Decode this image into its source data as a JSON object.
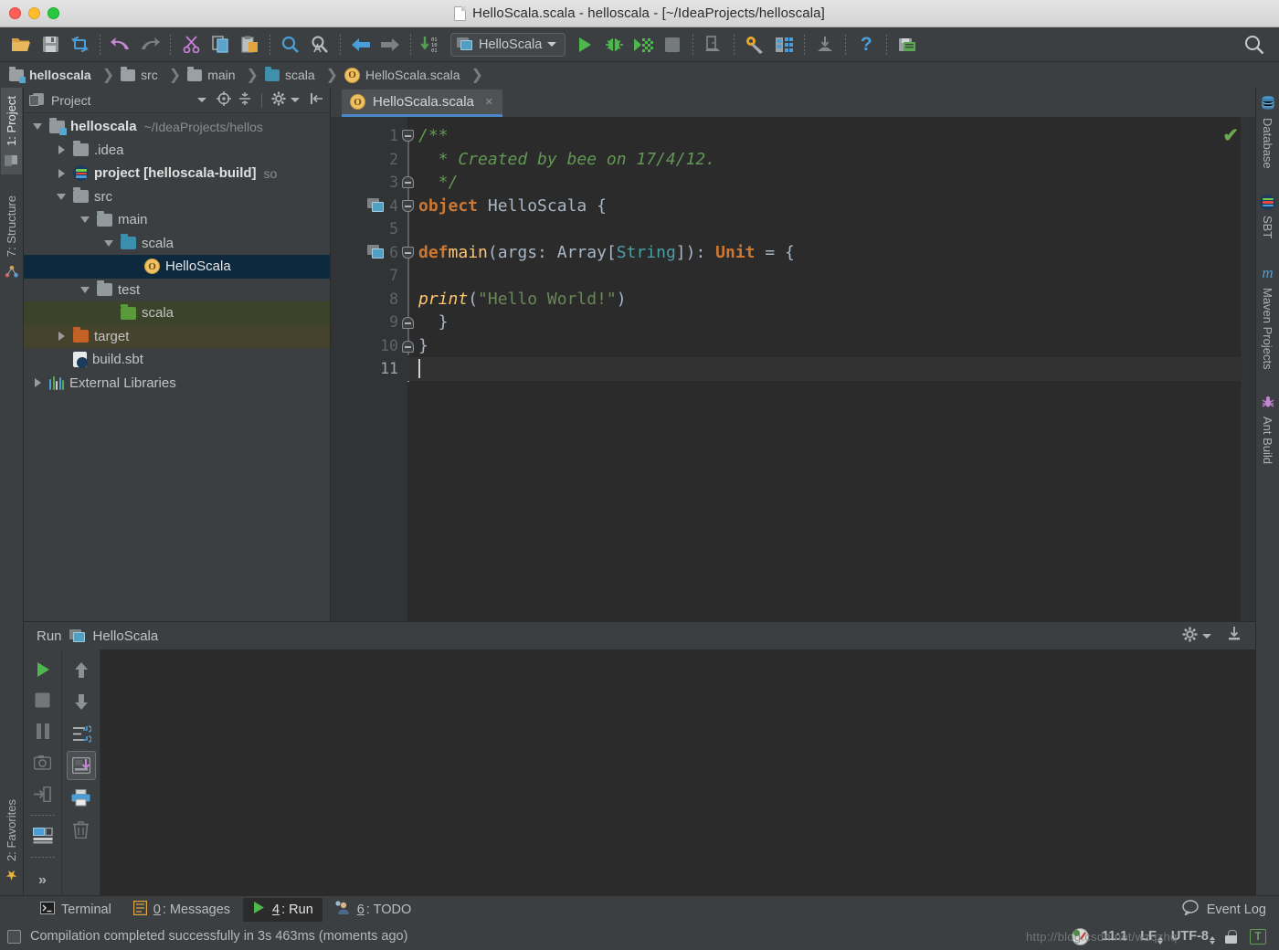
{
  "window": {
    "title": "HelloScala.scala - helloscala - [~/IdeaProjects/helloscala]",
    "file_icon": "file-icon"
  },
  "toolbar": {
    "items": [
      {
        "name": "open-project-icon",
        "label": "Open"
      },
      {
        "name": "save-all-icon",
        "label": "Save All"
      },
      {
        "name": "synchronize-icon",
        "label": "Synchronize"
      },
      {
        "name": "undo-icon",
        "label": "Undo"
      },
      {
        "name": "redo-icon",
        "label": "Redo"
      },
      {
        "name": "cut-icon",
        "label": "Cut"
      },
      {
        "name": "copy-icon",
        "label": "Copy"
      },
      {
        "name": "paste-icon",
        "label": "Paste"
      },
      {
        "name": "find-icon",
        "label": "Find"
      },
      {
        "name": "replace-icon",
        "label": "Replace"
      },
      {
        "name": "back-icon",
        "label": "Back"
      },
      {
        "name": "forward-icon",
        "label": "Forward"
      },
      {
        "name": "compile-icon",
        "label": "Compile"
      },
      {
        "name": "run-icon",
        "label": "Run"
      },
      {
        "name": "debug-icon",
        "label": "Debug"
      },
      {
        "name": "run-coverage-icon",
        "label": "Run with Coverage"
      },
      {
        "name": "stop-icon",
        "label": "Stop"
      },
      {
        "name": "update-app-icon",
        "label": "Update Application"
      },
      {
        "name": "settings-icon",
        "label": "Settings"
      },
      {
        "name": "project-structure-icon",
        "label": "Project Structure"
      },
      {
        "name": "install-icon",
        "label": "Install"
      },
      {
        "name": "help-icon",
        "label": "Help"
      },
      {
        "name": "sbt-refresh-icon",
        "label": "SBT"
      },
      {
        "name": "search-everywhere-icon",
        "label": "Search Everywhere"
      }
    ],
    "run_config": {
      "name": "HelloScala",
      "icon": "run-config-icon",
      "chevron": "chevron-down-icon"
    },
    "help_glyph": "?"
  },
  "breadcrumb": [
    {
      "label": "helloscala",
      "icon": "module-folder-icon",
      "bold": true
    },
    {
      "label": "src",
      "icon": "folder-icon",
      "bold": false
    },
    {
      "label": "main",
      "icon": "folder-icon",
      "bold": false
    },
    {
      "label": "scala",
      "icon": "source-folder-icon",
      "bold": false
    },
    {
      "label": "HelloScala.scala",
      "icon": "scala-object-icon",
      "bold": false
    }
  ],
  "left_sidebar": [
    {
      "label": "1: Project",
      "active": true,
      "icon": "project-icon"
    },
    {
      "label": "7: Structure",
      "active": false,
      "icon": "structure-icon"
    },
    {
      "label": "2: Favorites",
      "active": false,
      "icon": "star-icon"
    }
  ],
  "right_sidebar": [
    {
      "label": "Database",
      "icon": "database-icon"
    },
    {
      "label": "SBT",
      "icon": "sbt-icon"
    },
    {
      "label": "Maven Projects",
      "icon": "maven-icon"
    },
    {
      "label": "Ant Build",
      "icon": "ant-icon"
    }
  ],
  "project_panel": {
    "title": "Project",
    "header_icons": [
      {
        "name": "project-view-icon"
      },
      {
        "name": "chevron-down-icon"
      },
      {
        "name": "locate-file-icon"
      },
      {
        "name": "collapse-all-icon"
      },
      {
        "name": "gear-icon"
      },
      {
        "name": "hide-panel-icon"
      }
    ],
    "tree": [
      {
        "label": "helloscala",
        "sub": "~/IdeaProjects/hellos",
        "depth": 0,
        "twisty": "open",
        "icon": "module-folder-icon",
        "bold": true,
        "state": "none"
      },
      {
        "label": ".idea",
        "sub": "",
        "depth": 1,
        "twisty": "closed",
        "icon": "folder-icon",
        "bold": false,
        "state": "none"
      },
      {
        "label": "project [helloscala-build]",
        "sub": "so",
        "depth": 1,
        "twisty": "closed",
        "icon": "sbt-module-icon",
        "bold": true,
        "state": "none"
      },
      {
        "label": "src",
        "sub": "",
        "depth": 1,
        "twisty": "open",
        "icon": "folder-icon",
        "bold": false,
        "state": "none"
      },
      {
        "label": "main",
        "sub": "",
        "depth": 2,
        "twisty": "open",
        "icon": "folder-icon",
        "bold": false,
        "state": "none"
      },
      {
        "label": "scala",
        "sub": "",
        "depth": 3,
        "twisty": "open",
        "icon": "source-folder-icon",
        "bold": false,
        "state": "none"
      },
      {
        "label": "HelloScala",
        "sub": "",
        "depth": 4,
        "twisty": "none",
        "icon": "scala-object-icon",
        "bold": false,
        "state": "selected"
      },
      {
        "label": "test",
        "sub": "",
        "depth": 2,
        "twisty": "open",
        "icon": "folder-icon",
        "bold": false,
        "state": "none"
      },
      {
        "label": "scala",
        "sub": "",
        "depth": 3,
        "twisty": "none",
        "icon": "test-source-folder-icon",
        "bold": false,
        "state": "green"
      },
      {
        "label": "target",
        "sub": "",
        "depth": 1,
        "twisty": "closed",
        "icon": "excluded-folder-icon",
        "bold": false,
        "state": "olive"
      },
      {
        "label": "build.sbt",
        "sub": "",
        "depth": 1,
        "twisty": "none",
        "icon": "sbt-file-icon",
        "bold": false,
        "state": "none"
      },
      {
        "label": "External Libraries",
        "sub": "",
        "depth": 0,
        "twisty": "closed",
        "icon": "libraries-icon",
        "bold": false,
        "state": "none"
      }
    ]
  },
  "editor": {
    "tab": {
      "label": "HelloScala.scala",
      "icon": "scala-object-icon",
      "close": "×"
    },
    "inspection_status": "✔",
    "lines": [
      {
        "n": "1",
        "gutter_run": false,
        "fold": "down"
      },
      {
        "n": "2",
        "gutter_run": false,
        "fold": "none"
      },
      {
        "n": "3",
        "gutter_run": false,
        "fold": "up"
      },
      {
        "n": "4",
        "gutter_run": true,
        "fold": "down"
      },
      {
        "n": "5",
        "gutter_run": false,
        "fold": "none"
      },
      {
        "n": "6",
        "gutter_run": true,
        "fold": "down"
      },
      {
        "n": "7",
        "gutter_run": false,
        "fold": "none"
      },
      {
        "n": "8",
        "gutter_run": false,
        "fold": "none"
      },
      {
        "n": "9",
        "gutter_run": false,
        "fold": "up"
      },
      {
        "n": "10",
        "gutter_run": false,
        "fold": "up"
      },
      {
        "n": "11",
        "gutter_run": false,
        "fold": "none"
      }
    ],
    "code_text": [
      "/**",
      "  * Created by bee on 17/4/12.",
      "  */",
      "object HelloScala {",
      "",
      "  def main(args: Array[String]): Unit = {",
      "",
      "    print(\"Hello World!\")",
      "  }",
      "}",
      ""
    ],
    "cursor_line": 11
  },
  "run_window": {
    "title": "Run",
    "config_name": "HelloScala",
    "config_icon": "run-config-icon",
    "header_icons": [
      {
        "name": "gear-icon"
      },
      {
        "name": "hide-panel-icon"
      }
    ],
    "left_tools": [
      {
        "name": "rerun-button",
        "label": "Rerun"
      },
      {
        "name": "stop-button",
        "label": "Stop"
      },
      {
        "name": "pause-button",
        "label": "Pause Output"
      },
      {
        "name": "dump-threads-button",
        "label": "Dump Threads"
      },
      {
        "name": "exit-button",
        "label": "Exit"
      },
      {
        "name": "restore-layout-button",
        "label": "Restore Layout"
      }
    ],
    "right_tools": [
      {
        "name": "up-stacktrace-button",
        "label": "Up the Stack Trace"
      },
      {
        "name": "down-stacktrace-button",
        "label": "Down the Stack Trace"
      },
      {
        "name": "soft-wrap-button",
        "label": "Soft-Wrap"
      },
      {
        "name": "scroll-to-end-button",
        "label": "Scroll to End"
      },
      {
        "name": "print-button",
        "label": "Print"
      },
      {
        "name": "clear-all-button",
        "label": "Clear All"
      }
    ],
    "expand_glyph": "»",
    "console_text": ""
  },
  "bottom_tabs": [
    {
      "label": "Terminal",
      "num": "",
      "icon": "terminal-icon",
      "active": false
    },
    {
      "label": ": Messages",
      "num": "0",
      "icon": "messages-icon",
      "active": false
    },
    {
      "label": ": Run",
      "num": "4",
      "icon": "run-icon",
      "active": true
    },
    {
      "label": ": TODO",
      "num": "6",
      "icon": "todo-icon",
      "active": false
    }
  ],
  "event_log": {
    "label": "Event Log",
    "icon": "balloon-icon"
  },
  "status_bar": {
    "message": "Compilation completed successfully in 3s 463ms (moments ago)",
    "caret_position": "11:1",
    "line_separator": "LF",
    "encoding": "UTF-8",
    "lock_icon": "lock-icon",
    "indent_badge": "T",
    "memory_icon": "memory-indicator-icon",
    "watermark": "http://blog.csdn.net/wzqzhq"
  },
  "colors": {
    "accent_blue": "#4a88c7",
    "selection": "#0d293e",
    "editor_bg": "#2b2b2b",
    "panel_bg": "#3c3f41",
    "gutter_bg": "#313335",
    "keyword": "#cc7832",
    "comment": "#629755",
    "string": "#6a8759",
    "function": "#ffc66d",
    "type": "#4a9fa5",
    "default_text": "#a9b7c6",
    "success_green": "#6aa84f"
  }
}
